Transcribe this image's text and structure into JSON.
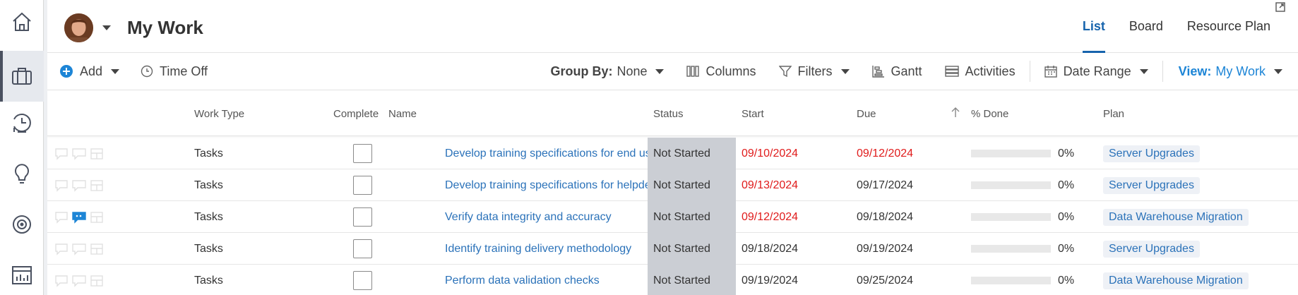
{
  "rail": {
    "items": [
      {
        "name": "home-icon"
      },
      {
        "name": "briefcase-icon",
        "active": true
      },
      {
        "name": "clock-icon"
      },
      {
        "name": "lightbulb-icon"
      },
      {
        "name": "target-icon"
      },
      {
        "name": "dashboard-icon"
      }
    ]
  },
  "header": {
    "title": "My Work",
    "tabs": [
      {
        "label": "List",
        "active": true
      },
      {
        "label": "Board"
      },
      {
        "label": "Resource Plan"
      }
    ]
  },
  "toolbar": {
    "add_label": "Add",
    "timeoff_label": "Time Off",
    "groupby_label": "Group By:",
    "groupby_value": "None",
    "columns_label": "Columns",
    "filters_label": "Filters",
    "gantt_label": "Gantt",
    "activities_label": "Activities",
    "daterange_label": "Date Range",
    "view_label": "View:",
    "view_value": "My Work"
  },
  "table": {
    "columns": {
      "work_type": "Work Type",
      "complete": "Complete",
      "name": "Name",
      "status": "Status",
      "start": "Start",
      "due": "Due",
      "done": "% Done",
      "plan": "Plan"
    },
    "rows": [
      {
        "work_type": "Tasks",
        "name": "Develop training specifications for end users",
        "status": "Not Started",
        "start": "09/10/2024",
        "start_overdue": true,
        "due": "09/12/2024",
        "due_overdue": true,
        "done": "0%",
        "plan": "Server Upgrades",
        "has_comment": false
      },
      {
        "work_type": "Tasks",
        "name": "Develop training specifications for helpdesk",
        "status": "Not Started",
        "start": "09/13/2024",
        "start_overdue": true,
        "due": "09/17/2024",
        "due_overdue": false,
        "done": "0%",
        "plan": "Server Upgrades",
        "has_comment": false
      },
      {
        "work_type": "Tasks",
        "name": "Verify data integrity and accuracy",
        "status": "Not Started",
        "start": "09/12/2024",
        "start_overdue": true,
        "due": "09/18/2024",
        "due_overdue": false,
        "done": "0%",
        "plan": "Data Warehouse Migration",
        "has_comment": true
      },
      {
        "work_type": "Tasks",
        "name": "Identify training delivery methodology",
        "status": "Not Started",
        "start": "09/18/2024",
        "start_overdue": false,
        "due": "09/19/2024",
        "due_overdue": false,
        "done": "0%",
        "plan": "Server Upgrades",
        "has_comment": false
      },
      {
        "work_type": "Tasks",
        "name": "Perform data validation checks",
        "status": "Not Started",
        "start": "09/19/2024",
        "start_overdue": false,
        "due": "09/25/2024",
        "due_overdue": false,
        "done": "0%",
        "plan": "Data Warehouse Migration",
        "has_comment": false
      }
    ]
  },
  "colors": {
    "accent": "#1764ad",
    "link": "#2b72b9",
    "overdue": "#e01b1b",
    "status_bg": "#cbced4",
    "comment_active": "#1d85d6"
  }
}
